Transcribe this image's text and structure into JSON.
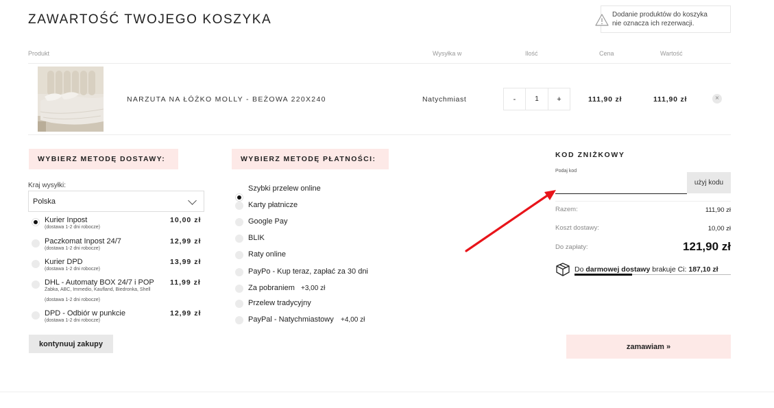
{
  "page_title": "ZAWARTOŚĆ TWOJEGO KOSZYKA",
  "notice": {
    "line1": "Dodanie produktów do koszyka",
    "line2": "nie oznacza ich rezerwacji.",
    "icon": "warning-triangle-icon"
  },
  "table_headers": {
    "product": "Produkt",
    "shipping": "Wysyłka w",
    "quantity": "Ilość",
    "price": "Cena",
    "value": "Wartość"
  },
  "cart_item": {
    "name": "NARZUTA NA ŁÓŻKO MOLLY - BEŻOWA 220X240",
    "shipping": "Natychmiast",
    "qty_minus": "-",
    "quantity": "1",
    "qty_plus": "+",
    "price": "111,90 zł",
    "value": "111,90 zł",
    "remove_symbol": "×"
  },
  "delivery": {
    "heading": "WYBIERZ METODĘ DOSTAWY:",
    "country_label": "Kraj wysyłki:",
    "country": "Polska",
    "options": [
      {
        "name": "Kurier Inpost",
        "sub": "(dostawa 1-2 dni robocze)",
        "price": "10,00 zł",
        "selected": true
      },
      {
        "name": "Paczkomat Inpost 24/7",
        "sub": "(dostawa 1-2 dni robocze)",
        "price": "12,99 zł",
        "selected": false
      },
      {
        "name": "Kurier DPD",
        "sub": "(dostawa 1-2 dni robocze)",
        "price": "13,99 zł",
        "selected": false
      },
      {
        "name": "DHL - Automaty BOX 24/7 i POP",
        "sub": "Żabka, ABC, Immedio, Kaufland, Biedronka, Shell",
        "sub2": "(dostawa 1-2 dni robocze)",
        "price": "11,99 zł",
        "selected": false
      },
      {
        "name": "DPD - Odbiór w punkcie",
        "sub": "(dostawa 1-2 dni robocze)",
        "price": "12,99 zł",
        "selected": false
      }
    ],
    "continue_label": "kontynuuj zakupy"
  },
  "payment": {
    "heading": "WYBIERZ METODĘ PŁATNOŚCI:",
    "options": [
      {
        "name": "Szybki przelew online",
        "extra": "",
        "selected": true
      },
      {
        "name": "Karty płatnicze",
        "extra": "",
        "selected": false
      },
      {
        "name": "Google Pay",
        "extra": "",
        "selected": false
      },
      {
        "name": "BLIK",
        "extra": "",
        "selected": false
      },
      {
        "name": "Raty online",
        "extra": "",
        "selected": false
      },
      {
        "name": "PayPo - Kup teraz, zapłać za 30 dni",
        "extra": "",
        "selected": false
      },
      {
        "name": "Za pobraniem",
        "extra": "+3,00 zł",
        "selected": false
      },
      {
        "name": "Przelew tradycyjny",
        "extra": "",
        "selected": false
      },
      {
        "name": "PayPal - Natychmiastowy",
        "extra": "+4,00 zł",
        "selected": false
      }
    ]
  },
  "discount": {
    "title": "KOD ZNIŻKOWY",
    "label": "Podaj kod",
    "value": "",
    "button": "użyj kodu"
  },
  "summary": {
    "subtotal_label": "Razem:",
    "subtotal": "111,90 zł",
    "shipping_label": "Koszt dostawy:",
    "shipping": "10,00 zł",
    "total_label": "Do zapłaty:",
    "total": "121,90 zł"
  },
  "free_shipping": {
    "prefix": "Do",
    "highlight": "darmowej dostawy",
    "middle": "brakuje Ci:",
    "amount": "187,10 zł",
    "progress": 0.37,
    "icon": "package-box-icon"
  },
  "order_button": "zamawiam »",
  "colors": {
    "accent_pink": "#fde9e7",
    "arrow_red": "#e8141a"
  }
}
